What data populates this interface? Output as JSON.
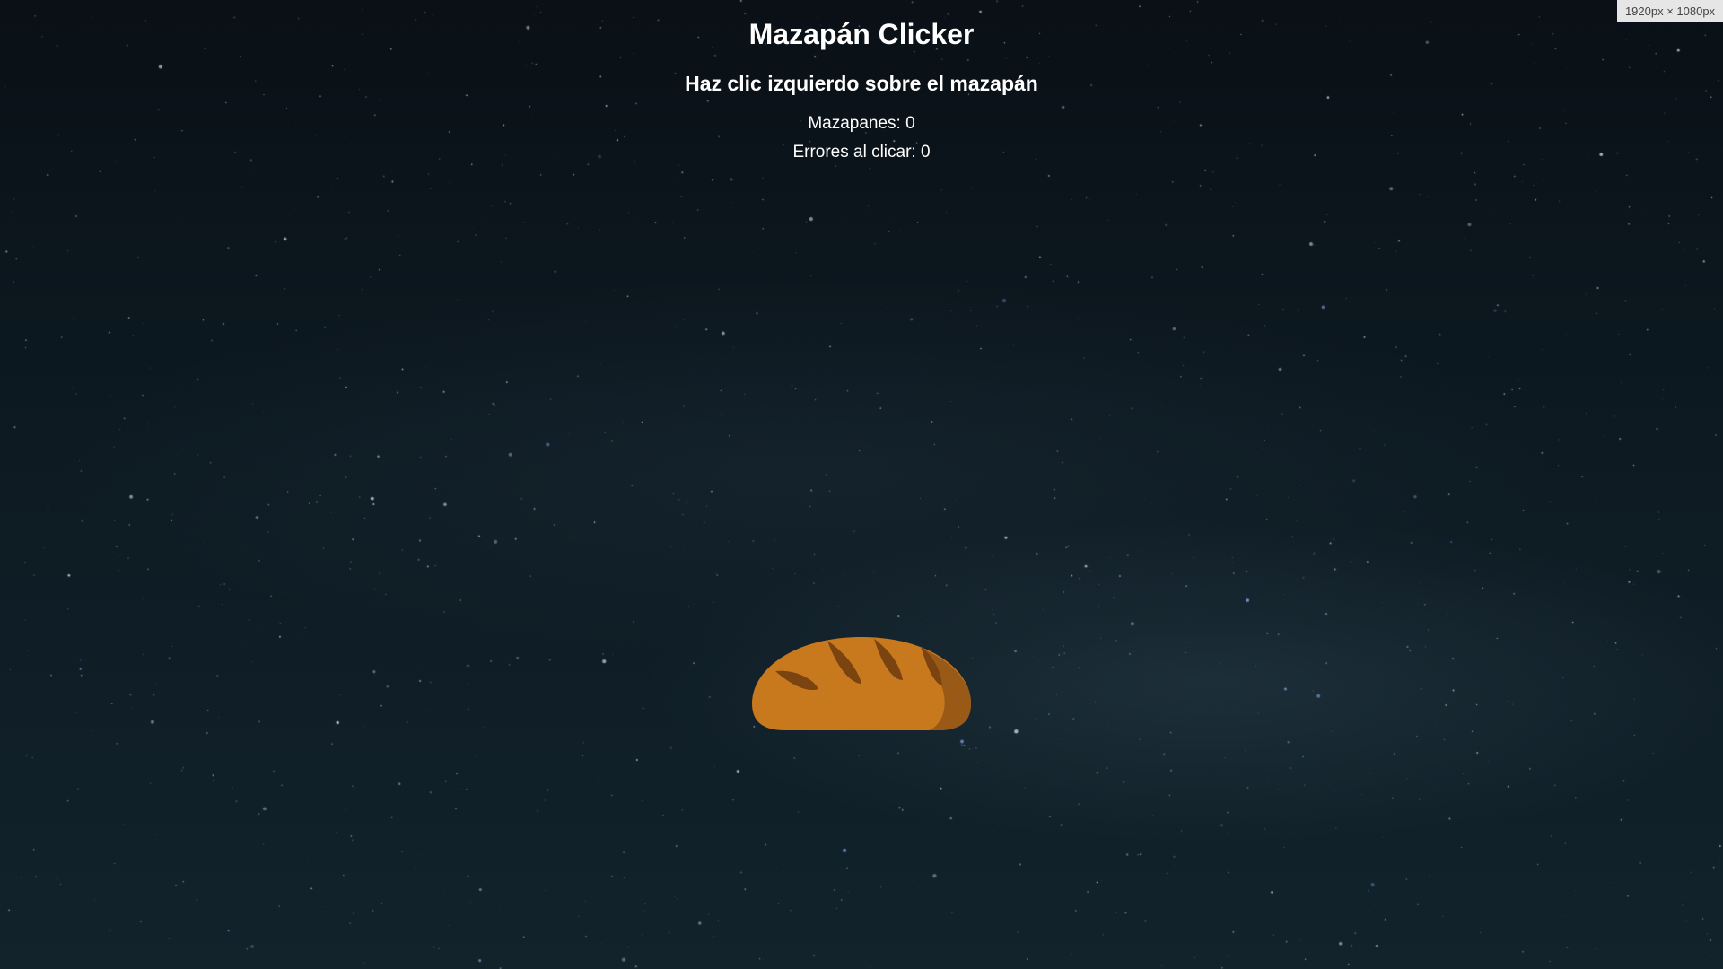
{
  "game": {
    "title": "Mazapán Clicker",
    "instruction": "Haz clic izquierdo sobre el mazapán",
    "score_label": "Mazapanes",
    "score": 0,
    "errors_label": "Errores al clicar",
    "errors": 0,
    "target_icon": "bread-icon"
  },
  "viewport_badge": "1920px × 1080px",
  "colors": {
    "text": "#ffffff",
    "bread_main": "#c8781d",
    "bread_dark": "#9a5a17",
    "bread_score": "#7a4310"
  }
}
